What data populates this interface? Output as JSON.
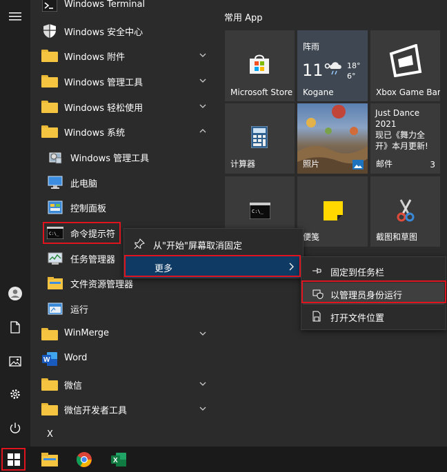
{
  "app_list": {
    "items": [
      {
        "label": "Windows Terminal",
        "icon": "terminal-icon"
      },
      {
        "label": "Windows 安全中心",
        "icon": "shield-icon"
      },
      {
        "label": "Windows 附件",
        "icon": "folder-icon"
      },
      {
        "label": "Windows 管理工具",
        "icon": "folder-icon"
      },
      {
        "label": "Windows 轻松使用",
        "icon": "folder-icon"
      },
      {
        "label": "Windows 系统",
        "icon": "folder-icon"
      },
      {
        "label": "Windows 管理工具",
        "icon": "admin-tools-icon"
      },
      {
        "label": "此电脑",
        "icon": "computer-icon"
      },
      {
        "label": "控制面板",
        "icon": "control-panel-icon"
      },
      {
        "label": "命令提示符",
        "icon": "cmd-icon"
      },
      {
        "label": "任务管理器",
        "icon": "task-manager-icon"
      },
      {
        "label": "文件资源管理器",
        "icon": "file-explorer-icon"
      },
      {
        "label": "运行",
        "icon": "run-icon"
      },
      {
        "label": "WinMerge",
        "icon": "folder-icon"
      },
      {
        "label": "Word",
        "icon": "word-icon"
      },
      {
        "label": "微信",
        "icon": "folder-icon"
      },
      {
        "label": "微信开发者工具",
        "icon": "folder-icon"
      },
      {
        "label": "X",
        "icon": ""
      }
    ]
  },
  "tiles": {
    "group_title": "常用 App",
    "ms_store": "Microsoft Store",
    "weather": {
      "condition": "阵雨",
      "temp": "11°",
      "high": "18°",
      "low": "6°",
      "city": "Kogane"
    },
    "xbox": "Xbox Game Bar",
    "calculator": "计算器",
    "photos": "照片",
    "mail": {
      "title_line1": "Just Dance",
      "title_line2": "2021",
      "text_line1": "现已《舞力全",
      "text_line2": "开》本月更新!",
      "label": "邮件",
      "count": "3"
    },
    "cmd_tile": "",
    "sticky": "便笺",
    "snip": "截图和草图"
  },
  "context_menu": {
    "unpin": "从\"开始\"屏幕取消固定",
    "more": "更多"
  },
  "submenu": {
    "pin_taskbar": "固定到任务栏",
    "run_admin": "以管理员身份运行",
    "open_location": "打开文件位置"
  },
  "colors": {
    "highlight": "#e0141e",
    "accent_blue": "#0f3a63",
    "tile_bg": "#3a3a3a"
  }
}
